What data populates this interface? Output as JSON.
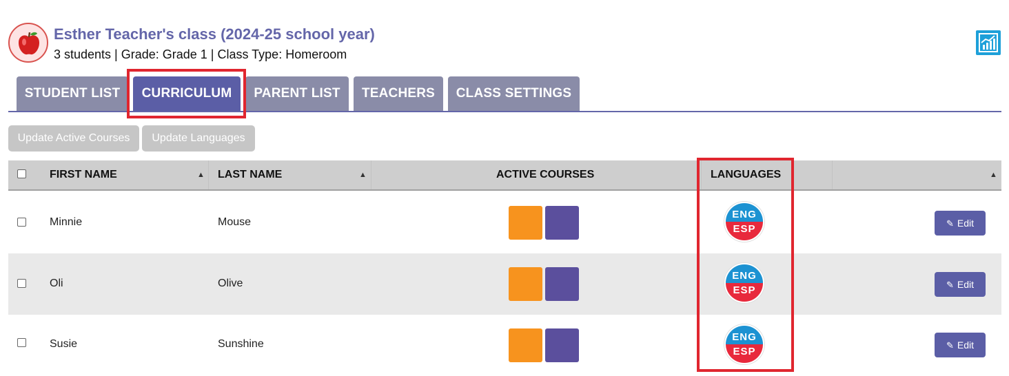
{
  "header": {
    "title": "Esther Teacher's class (2024-25 school year)",
    "subtitle": "3 students | Grade: Grade 1 | Class Type: Homeroom",
    "class_icon": "apple-icon",
    "report_icon": "chart-report-icon"
  },
  "tabs": [
    {
      "label": "STUDENT LIST",
      "active": false
    },
    {
      "label": "CURRICULUM",
      "active": true
    },
    {
      "label": "PARENT LIST",
      "active": false
    },
    {
      "label": "TEACHERS",
      "active": false
    },
    {
      "label": "CLASS SETTINGS",
      "active": false
    }
  ],
  "toolbar": {
    "update_courses": "Update Active Courses",
    "update_languages": "Update Languages"
  },
  "table": {
    "columns": {
      "first_name": "FIRST NAME",
      "last_name": "LAST NAME",
      "active_courses": "ACTIVE COURSES",
      "languages": "LANGUAGES"
    },
    "rows": [
      {
        "first": "Minnie",
        "last": "Mouse",
        "lang_top": "ENG",
        "lang_bottom": "ESP",
        "edit": "Edit"
      },
      {
        "first": "Oli",
        "last": "Olive",
        "lang_top": "ENG",
        "lang_bottom": "ESP",
        "edit": "Edit"
      },
      {
        "first": "Susie",
        "last": "Sunshine",
        "lang_top": "ENG",
        "lang_bottom": "ESP",
        "edit": "Edit"
      }
    ]
  },
  "colors": {
    "accent": "#5b5ea6",
    "tab_inactive": "#8a8ca8",
    "highlight": "#e0262f",
    "lang_blue": "#1c92d2",
    "lang_red": "#e8293c"
  }
}
